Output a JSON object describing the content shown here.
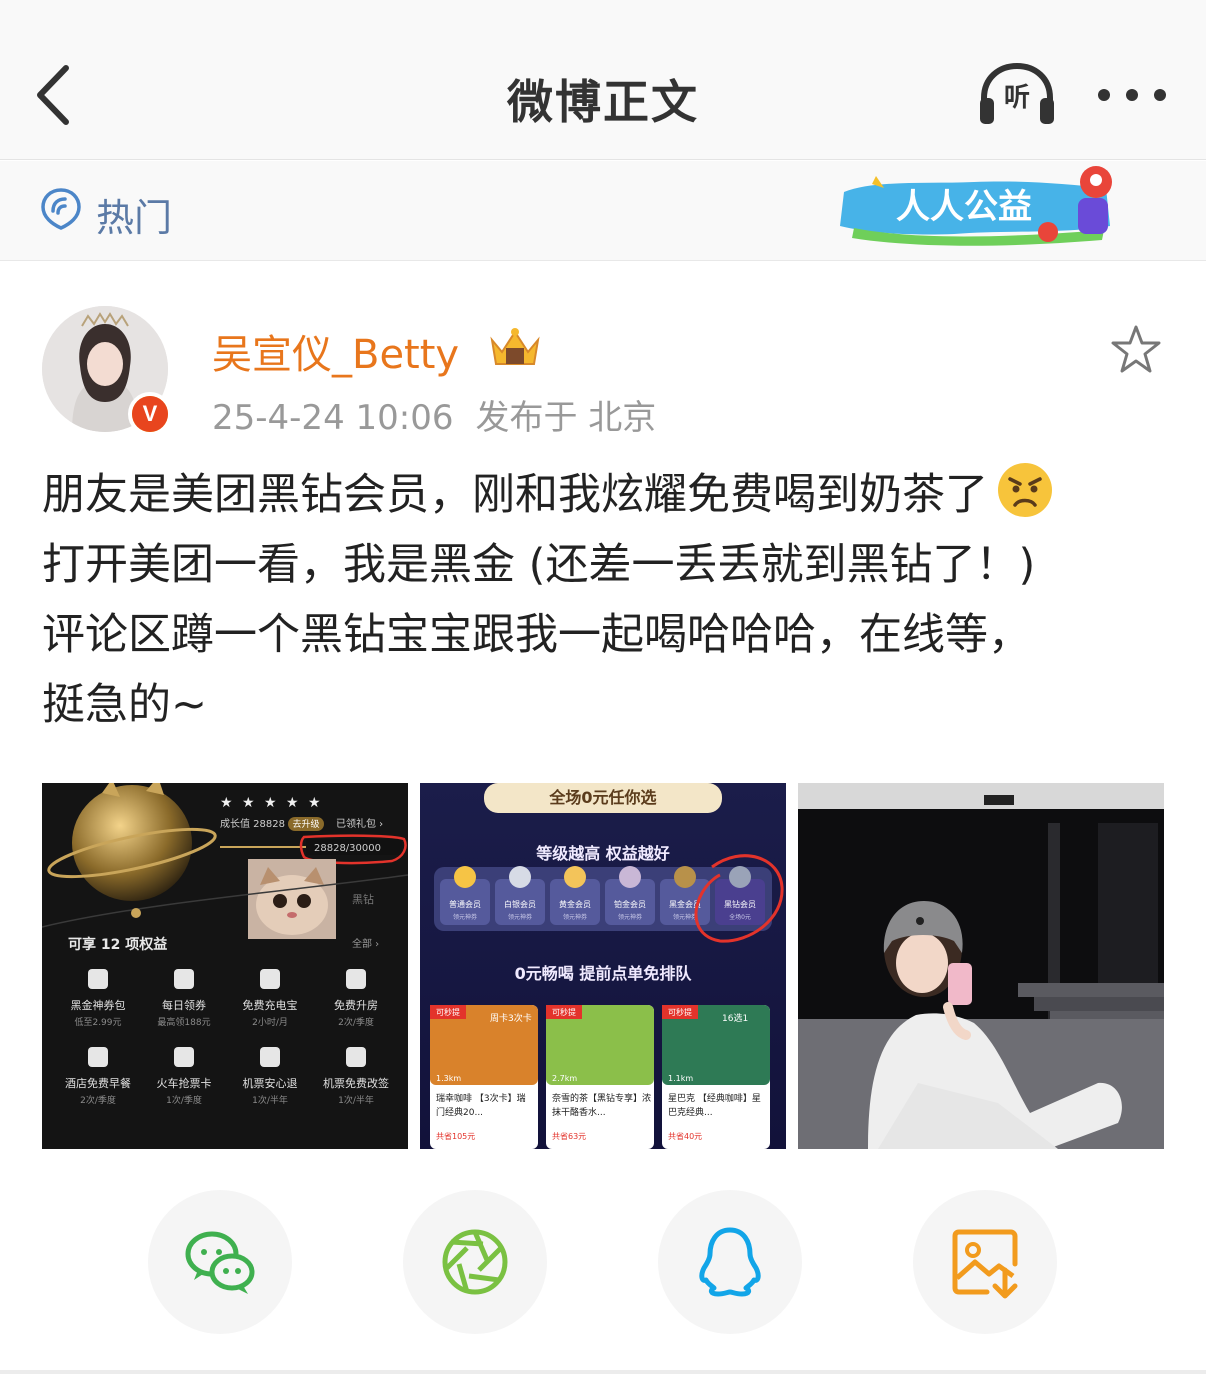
{
  "nav": {
    "title": "微博正文",
    "back_icon": "chevron-left-icon",
    "listen_label": "听",
    "more_icon": "more-dots-icon"
  },
  "hotbar": {
    "label": "热门",
    "banner_text": "人人公益"
  },
  "post": {
    "username": "吴宣仪_Betty",
    "verified_mark": "V",
    "time": "25-4-24 10:06",
    "location": "发布于 北京",
    "content_lines": [
      "朋友是美团黑钻会员，刚和我炫耀免费喝到奶茶了",
      "打开美团一看，我是黑金 (还差一丢丢就到黑钻了！)",
      "评论区蹲一个黑钻宝宝跟我一起喝哈哈哈，在线等，",
      "挺急的~"
    ]
  },
  "photo1": {
    "growth": "成长值 28828",
    "upgrade": "去升级",
    "gift": "已领礼包 ›",
    "progress_text": "28828/30000",
    "progress": 0.96,
    "tier": "黑钻",
    "benefits_title": "可享 12 项权益",
    "all": "全部 ›",
    "benefits": [
      {
        "name": "黑金神券包",
        "sub": "低至2.99元"
      },
      {
        "name": "每日领券",
        "sub": "最高领188元"
      },
      {
        "name": "免费充电宝",
        "sub": "2小时/月"
      },
      {
        "name": "免费升房",
        "sub": "2次/季度"
      },
      {
        "name": "酒店免费早餐",
        "sub": "2次/季度"
      },
      {
        "name": "火车抢票卡",
        "sub": "1次/季度"
      },
      {
        "name": "机票安心退",
        "sub": "1次/半年"
      },
      {
        "name": "机票免费改签",
        "sub": "1次/半年"
      }
    ]
  },
  "photo2": {
    "top_banner": "全场0元任你选",
    "level_title": "等级越高 权益越好",
    "levels": [
      "普通会员",
      "白银会员",
      "黄金会员",
      "铂金会员",
      "黑金会员",
      "黑钻会员"
    ],
    "level_sub": [
      "领元神券",
      "领元神券",
      "领元神券",
      "领元神券",
      "领元神券",
      "全场0元"
    ],
    "free_title": "0元畅喝 提前点单免排队",
    "cards": [
      {
        "tag": "可秒提",
        "promo": "周卡3次卡",
        "distance": "1.3km",
        "title": "瑞幸咖啡 【3次卡】瑞门经典20...",
        "save": "共省105元",
        "color": "#d9822b"
      },
      {
        "tag": "可秒提",
        "promo": "",
        "distance": "2.7km",
        "title": "奈雪的茶【黑钻专享】浓抹干酪香水...",
        "save": "共省63元",
        "color": "#8bbf4a"
      },
      {
        "tag": "可秒提",
        "promo": "16选1",
        "distance": "1.1km",
        "title": "星巴克 【经典咖啡】星巴克经典...",
        "save": "共省40元",
        "color": "#2e7a55"
      }
    ]
  },
  "share": [
    {
      "icon": "wechat-icon",
      "color": "#3fb04f"
    },
    {
      "icon": "moments-icon",
      "color": "#7ac142"
    },
    {
      "icon": "qq-icon",
      "color": "#12a5e8"
    },
    {
      "icon": "save-image-icon",
      "color": "#f29b1d"
    }
  ]
}
